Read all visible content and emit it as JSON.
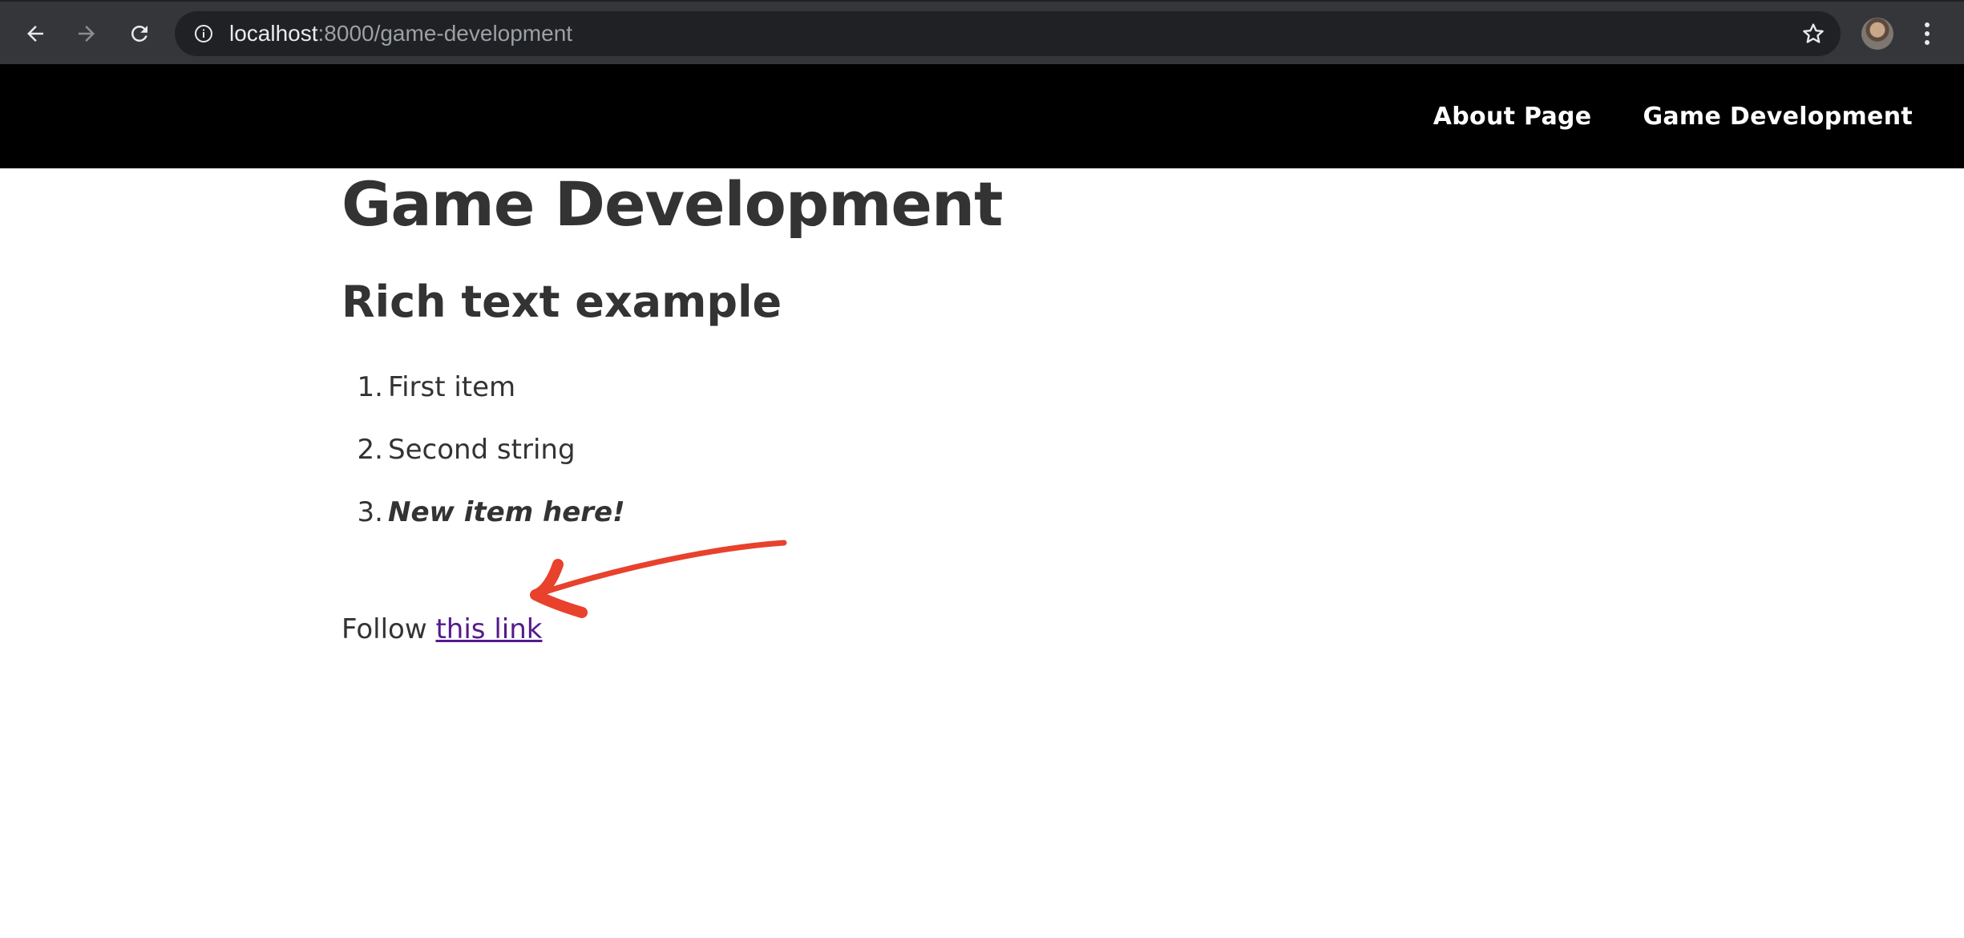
{
  "browser": {
    "url_host": "localhost",
    "url_path": ":8000/game-development",
    "icons": [
      "back-arrow-icon",
      "forward-arrow-icon",
      "reload-icon",
      "info-icon",
      "star-icon",
      "profile-avatar",
      "kebab-menu-icon"
    ]
  },
  "site_nav": {
    "items": [
      {
        "label": "About Page"
      },
      {
        "label": "Game Development"
      }
    ]
  },
  "main": {
    "page_title": "Game Development",
    "section_title": "Rich text example",
    "list": [
      {
        "num": "1.",
        "text": "First item"
      },
      {
        "num": "2.",
        "text": "Second string"
      },
      {
        "num": "3.",
        "text": "New item here!"
      }
    ],
    "follow_prefix": "Follow ",
    "link_text": "this link"
  },
  "colors": {
    "browser_chrome": "#35363a",
    "header_bg": "#000000",
    "text": "#333333",
    "visited_link": "#551a8b",
    "annotation_arrow": "#e8412c"
  }
}
